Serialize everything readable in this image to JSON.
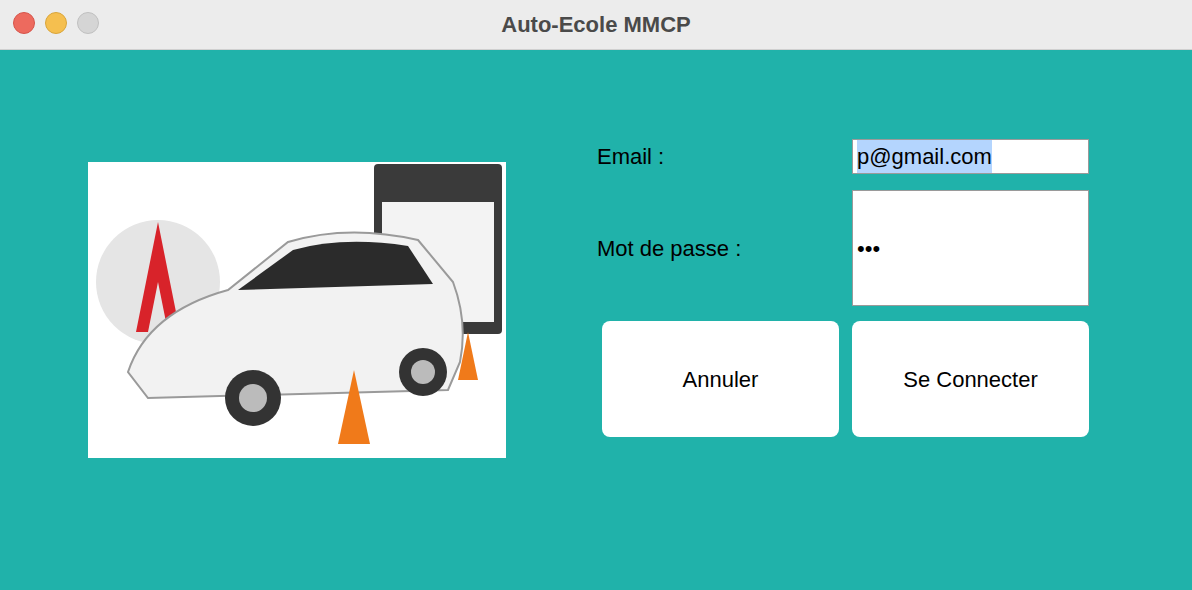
{
  "window": {
    "title": "Auto-Ecole MMCP"
  },
  "form": {
    "email": {
      "label": "Email :",
      "value": "p@gmail.com",
      "text_selected": true
    },
    "password": {
      "label": "Mot de passe :",
      "value": "•••"
    }
  },
  "buttons": [
    "Annuler",
    "Se Connecter"
  ]
}
